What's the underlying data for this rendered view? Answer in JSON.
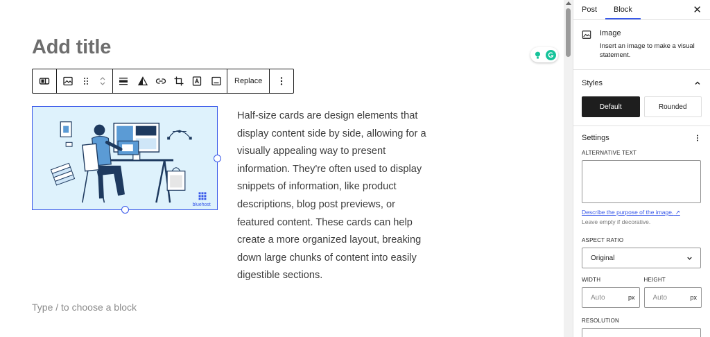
{
  "editor": {
    "title_placeholder": "Add title",
    "toolbar": {
      "replace_label": "Replace",
      "icons": [
        "block-type-icon",
        "image-icon",
        "drag-handle-icon",
        "move-up-down-icon",
        "align-icon",
        "duotone-icon",
        "link-icon",
        "crop-icon",
        "text-overlay-icon",
        "caption-icon",
        "more-options-icon"
      ]
    },
    "image_watermark": "bluehost",
    "paragraph": "Half-size cards are design elements that display content side by side, allowing for a visually appealing way to present information. They're often used to display snippets of information, like product descriptions, blog post previews, or featured content. These cards can help create a more organized layout, breaking down large chunks of content into easily digestible sections.",
    "block_placeholder": "Type / to choose a block"
  },
  "sidebar": {
    "tabs": [
      {
        "label": "Post",
        "active": false
      },
      {
        "label": "Block",
        "active": true
      }
    ],
    "close_icon": "close-icon",
    "block_card": {
      "title": "Image",
      "description": "Insert an image to make a visual statement."
    },
    "styles": {
      "heading": "Styles",
      "options": [
        {
          "label": "Default",
          "active": true
        },
        {
          "label": "Rounded",
          "active": false
        }
      ]
    },
    "settings": {
      "heading": "Settings",
      "alt_text_label": "ALTERNATIVE TEXT",
      "alt_text_value": "",
      "describe_link": "Describe the purpose of the image.",
      "leave_empty_hint": "Leave empty if decorative.",
      "aspect_ratio_label": "ASPECT RATIO",
      "aspect_ratio_value": "Original",
      "width_label": "WIDTH",
      "width_placeholder": "Auto",
      "width_unit": "px",
      "height_label": "HEIGHT",
      "height_placeholder": "Auto",
      "height_unit": "px",
      "resolution_label": "RESOLUTION"
    }
  },
  "colors": {
    "accent": "#3858e9",
    "grammarly_green": "#15c39a",
    "image_bg": "#def2fc"
  }
}
